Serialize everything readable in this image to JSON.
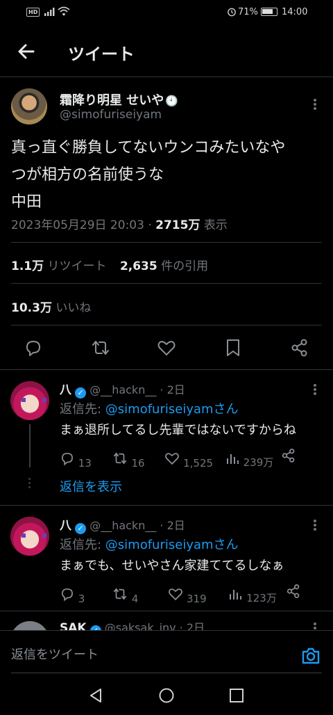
{
  "status_bar": {
    "hd": "HD",
    "battery_pct": "71%",
    "time": "14:00",
    "battery_level": 0.71
  },
  "header": {
    "title": "ツイート"
  },
  "main_tweet": {
    "name": "霜降り明星 せいや",
    "clock_emoji": "🕙",
    "handle": "@simofuriseiyam",
    "text_line1": "真っ直ぐ勝負してないウンコみたいなや",
    "text_line2": "つが相方の名前使うな",
    "text_line3": "中田",
    "timestamp": "2023年05月29日 20:03 · ",
    "views_value": "2715万",
    "views_label": " 表示",
    "retweets_value": "1.1万",
    "retweets_label": "リツイート",
    "quotes_value": "2,635",
    "quotes_label": "件の引用",
    "likes_value": "10.3万",
    "likes_label": "いいね"
  },
  "replies": [
    {
      "name": "八",
      "handle": "@__hackn__",
      "time": "2日",
      "reply_to_label": "返信先: ",
      "reply_to_handle": "@simofuriseiyamさん",
      "text": "まぁ退所してるし先輩ではないですからね",
      "replies": "13",
      "retweets": "16",
      "likes": "1,525",
      "views": "239万",
      "show_replies": "返信を表示"
    },
    {
      "name": "八",
      "handle": "@__hackn__",
      "time": "2日",
      "reply_to_label": "返信先: ",
      "reply_to_handle": "@simofuriseiyamさん",
      "text": "まぁでも、せいやさん家建ててるしなぁ",
      "replies": "3",
      "retweets": "4",
      "likes": "319",
      "views": "123万"
    },
    {
      "name": "SAK",
      "handle": "@saksak_inv",
      "time": "2日"
    }
  ],
  "compose": {
    "placeholder": "返信をツイート"
  },
  "colors": {
    "background": "#000000",
    "accent": "#1d9bf0",
    "muted": "#71767b",
    "text": "#e7e9ea",
    "separator": "#2f3336"
  }
}
